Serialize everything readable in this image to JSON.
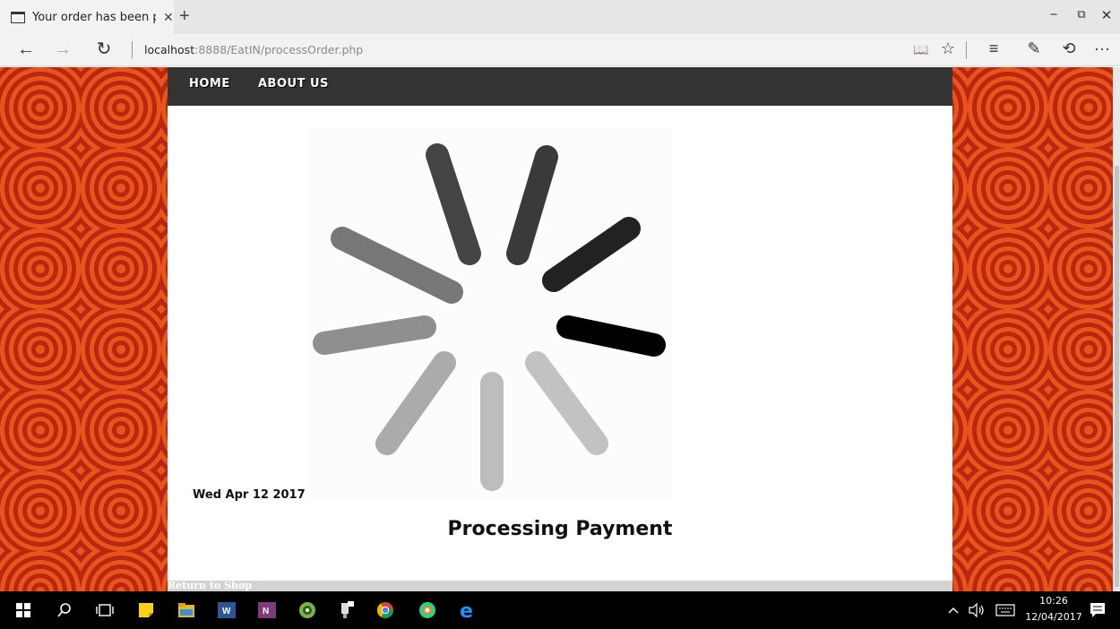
{
  "browser": {
    "tab_title": "Your order has been pro",
    "tab_close": "✕",
    "new_tab": "+",
    "window_controls": {
      "minimize": "−",
      "restore": "⧉",
      "close": "✕"
    },
    "nav": {
      "back": "←",
      "forward": "→",
      "refresh": "↻"
    },
    "address_host": "localhost",
    "address_rest": ":8888/EatIN/processOrder.php",
    "tools": {
      "reading_view": "📖",
      "favorite": "☆",
      "hub": "≡",
      "web_note": "✎",
      "share": "⟲",
      "more": "···"
    }
  },
  "site": {
    "nav": {
      "home": "HOME",
      "about": "ABOUT US"
    },
    "date": "Wed Apr 12 2017",
    "status": "Processing Payment",
    "footer_link": "Return to Shop"
  },
  "taskbar": {
    "time": "10:26",
    "date": "12/04/2017",
    "icons": [
      "windows-start-icon",
      "search-icon",
      "task-view-icon",
      "sticky-notes-icon",
      "file-explorer-icon",
      "word-icon",
      "onenote-icon",
      "android-studio-icon",
      "device-manager-icon",
      "chrome-icon",
      "pycharm-icon",
      "edge-icon"
    ]
  },
  "colors": {
    "site_nav_bg": "#333333",
    "wallpaper_red": "#d43a10",
    "wallpaper_orange": "#e8541c"
  }
}
